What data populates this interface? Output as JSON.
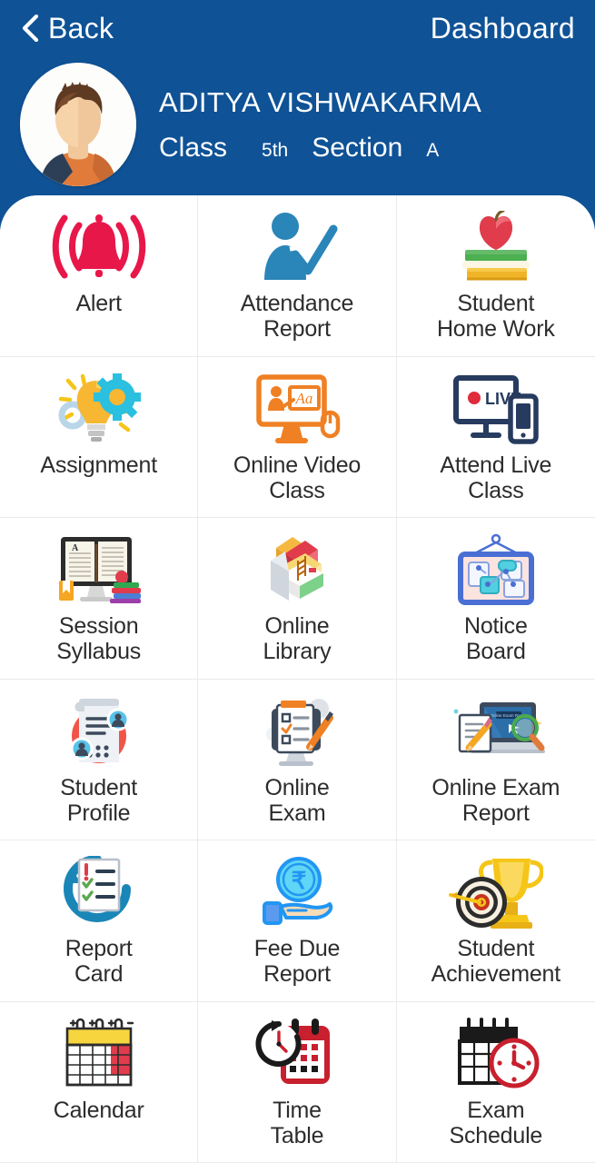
{
  "header": {
    "back_label": "Back",
    "back_icon": "chevron-left-icon",
    "title": "Dashboard",
    "background_color": "#0f5296"
  },
  "profile": {
    "avatar_icon": "student-avatar",
    "student_name": "ADITYA VISHWAKARMA",
    "class_label": "Class",
    "class_value": "5th",
    "section_label": "Section",
    "section_value": "A"
  },
  "menu": {
    "items": [
      {
        "label": "Alert",
        "icon": "alert-bell-icon"
      },
      {
        "label": "Attendance\nReport",
        "icon": "attendance-person-check-icon"
      },
      {
        "label": "Student\nHome Work",
        "icon": "books-apple-icon"
      },
      {
        "label": "Assignment",
        "icon": "lightbulb-gear-icon"
      },
      {
        "label": "Online Video\nClass",
        "icon": "video-monitor-icon"
      },
      {
        "label": "Attend Live\nClass",
        "icon": "live-stream-monitor-icon"
      },
      {
        "label": "Session\nSyllabus",
        "icon": "open-book-icon"
      },
      {
        "label": "Online\nLibrary",
        "icon": "library-books-icon"
      },
      {
        "label": "Notice\nBoard",
        "icon": "notice-board-icon"
      },
      {
        "label": "Student\nProfile",
        "icon": "profile-document-icon"
      },
      {
        "label": "Online\nExam",
        "icon": "exam-monitor-checklist-icon"
      },
      {
        "label": "Online Exam\nReport",
        "icon": "laptop-report-magnifier-icon"
      },
      {
        "label": "Report\nCard",
        "icon": "report-card-checklist-icon"
      },
      {
        "label": "Fee Due\nReport",
        "icon": "rupee-hand-icon"
      },
      {
        "label": "Student\nAchievement",
        "icon": "trophy-target-icon"
      },
      {
        "label": "Calendar",
        "icon": "calendar-icon"
      },
      {
        "label": "Time\nTable",
        "icon": "clock-calendar-icon"
      },
      {
        "label": "Exam\nSchedule",
        "icon": "calendar-clock-icon"
      }
    ]
  },
  "colors": {
    "header_blue": "#0f5296",
    "alert_red": "#e8174a",
    "attendance_blue": "#2a85b8",
    "assignment_orange": "#f5a623",
    "video_orange": "#ef8023",
    "live_navy": "#263b5e",
    "notice_blue": "#4a6fd4",
    "fee_cyan": "#35c3f0",
    "trophy_gold": "#f0b828",
    "label_text": "#2c2c2c",
    "divider": "#eaeaea"
  }
}
